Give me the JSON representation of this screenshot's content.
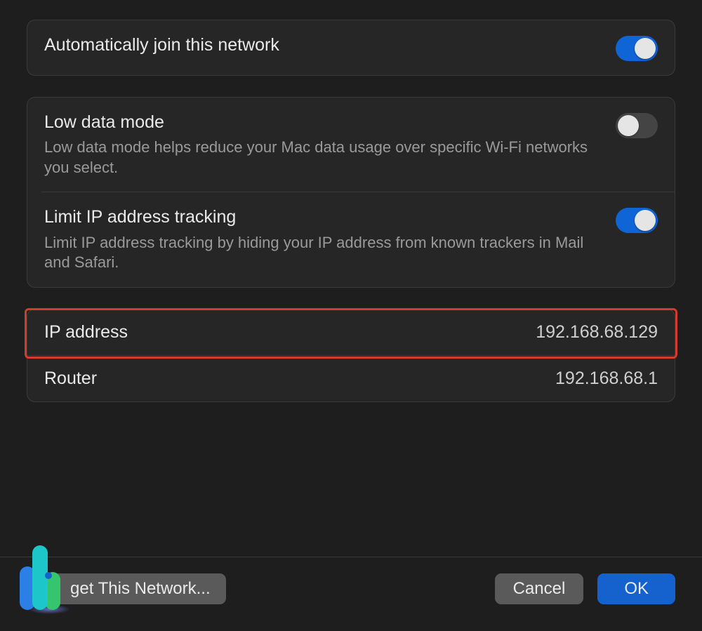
{
  "settings": {
    "autoJoin": {
      "title": "Automatically join this network",
      "enabled": true
    },
    "lowData": {
      "title": "Low data mode",
      "desc": "Low data mode helps reduce your Mac data usage over specific Wi-Fi networks you select.",
      "enabled": false
    },
    "limitIp": {
      "title": "Limit IP address tracking",
      "desc": "Limit IP address tracking by hiding your IP address from known trackers in Mail and Safari.",
      "enabled": true
    }
  },
  "network": {
    "ipLabel": "IP address",
    "ipValue": "192.168.68.129",
    "routerLabel": "Router",
    "routerValue": "192.168.68.1"
  },
  "footer": {
    "forget": "get This Network...",
    "cancel": "Cancel",
    "ok": "OK"
  }
}
